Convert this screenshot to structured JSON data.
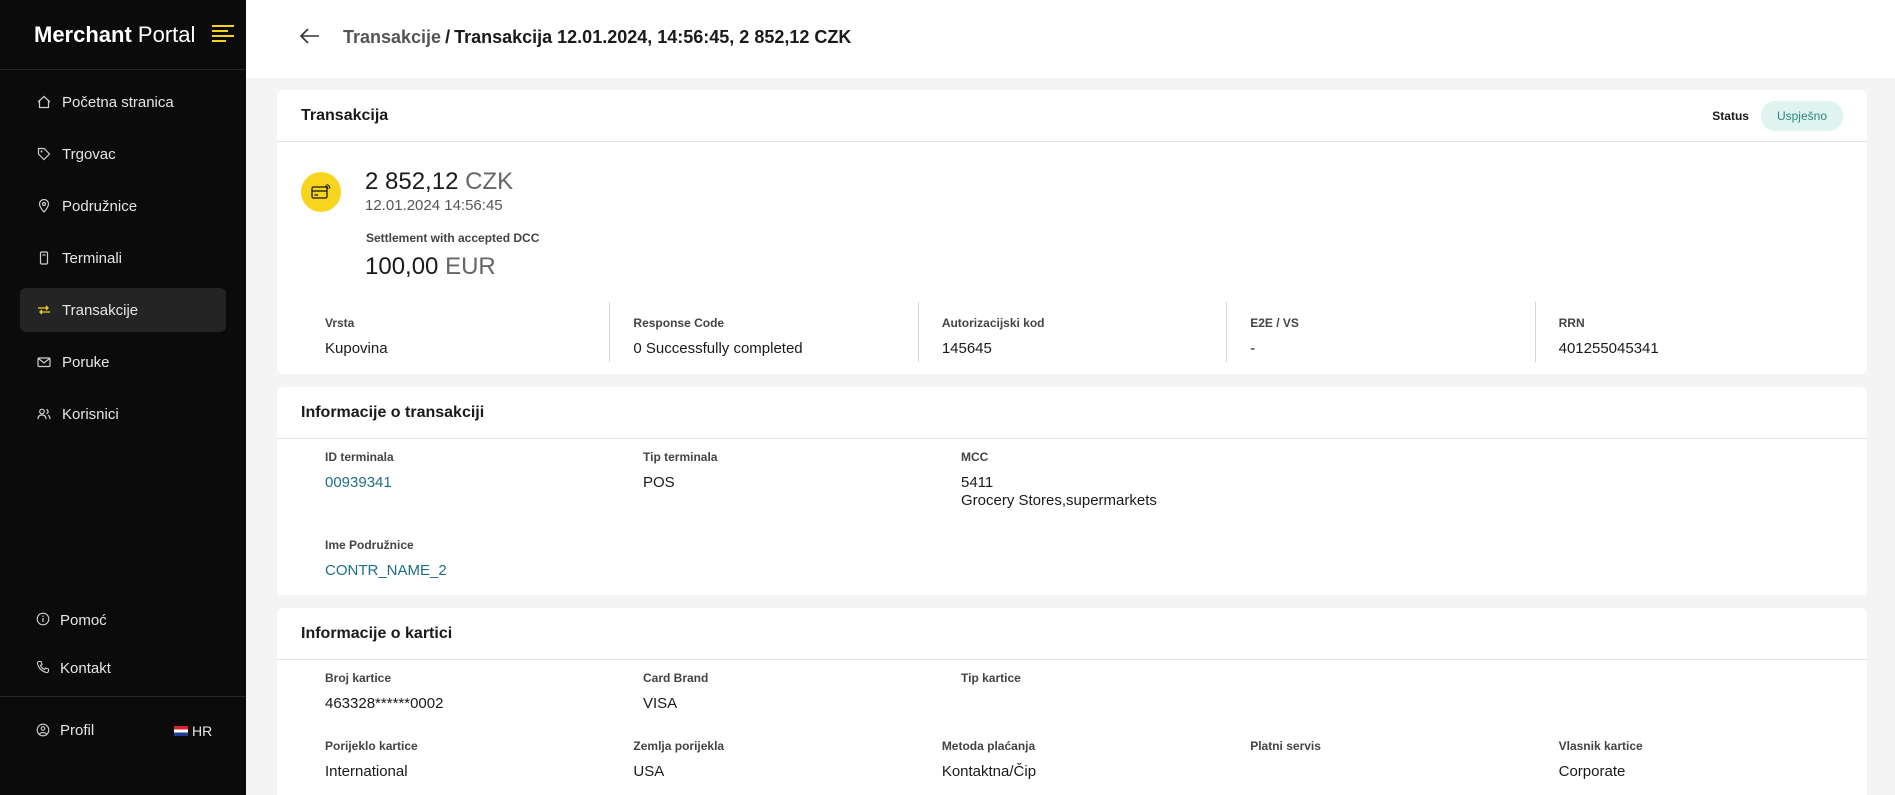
{
  "sidebar": {
    "brand_bold": "Merchant",
    "brand_light": " Portal",
    "items": [
      {
        "label": "Početna stranica",
        "icon": "home-icon",
        "active": false
      },
      {
        "label": "Trgovac",
        "icon": "tag-icon",
        "active": false
      },
      {
        "label": "Podružnice",
        "icon": "location-pin-icon",
        "active": false
      },
      {
        "label": "Terminali",
        "icon": "terminal-device-icon",
        "active": false
      },
      {
        "label": "Transakcije",
        "icon": "transfer-arrows-icon",
        "active": true
      },
      {
        "label": "Poruke",
        "icon": "mail-icon",
        "active": false
      },
      {
        "label": "Korisnici",
        "icon": "users-icon",
        "active": false
      }
    ],
    "bottom": [
      {
        "label": "Pomoć",
        "icon": "info-icon"
      },
      {
        "label": "Kontakt",
        "icon": "phone-icon"
      }
    ],
    "profile_label": "Profil",
    "language": "HR"
  },
  "header": {
    "breadcrumb_link": "Transakcije",
    "separator": "/",
    "breadcrumb_current": "Transakcija 12.01.2024, 14:56:45, 2 852,12 CZK"
  },
  "transaction": {
    "title": "Transakcija",
    "status_label": "Status",
    "status_value": "Uspješno",
    "amount": "2 852,12",
    "currency": "CZK",
    "datetime": "12.01.2024 14:56:45",
    "dcc_label": "Settlement with accepted DCC",
    "dcc_amount": "100,00",
    "dcc_currency": "EUR",
    "fields": [
      {
        "label": "Vrsta",
        "value": "Kupovina"
      },
      {
        "label": "Response Code",
        "value": "0 Successfully completed"
      },
      {
        "label": "Autorizacijski kod",
        "value": "145645"
      },
      {
        "label": "E2E / VS",
        "value": "-"
      },
      {
        "label": "RRN",
        "value": "401255045341"
      }
    ]
  },
  "info": {
    "title": "Informacije o transakciji",
    "terminal_id_label": "ID terminala",
    "terminal_id": "00939341",
    "terminal_type_label": "Tip terminala",
    "terminal_type": "POS",
    "mcc_label": "MCC",
    "mcc_code": "5411",
    "mcc_desc": "Grocery Stores,supermarkets",
    "branch_label": "Ime Podružnice",
    "branch": "CONTR_NAME_2"
  },
  "card": {
    "title": "Informacije o kartici",
    "row1": [
      {
        "label": "Broj kartice",
        "value": "463328******0002"
      },
      {
        "label": "Card Brand",
        "value": "VISA"
      },
      {
        "label": "Tip kartice",
        "value": ""
      }
    ],
    "row2": [
      {
        "label": "Porijeklo kartice",
        "value": "International"
      },
      {
        "label": "Zemlja porijekla",
        "value": "USA"
      },
      {
        "label": "Metoda plaćanja",
        "value": "Kontaktna/Čip"
      },
      {
        "label": "Platni servis",
        "value": ""
      },
      {
        "label": "Vlasnik kartice",
        "value": "Corporate"
      }
    ]
  }
}
